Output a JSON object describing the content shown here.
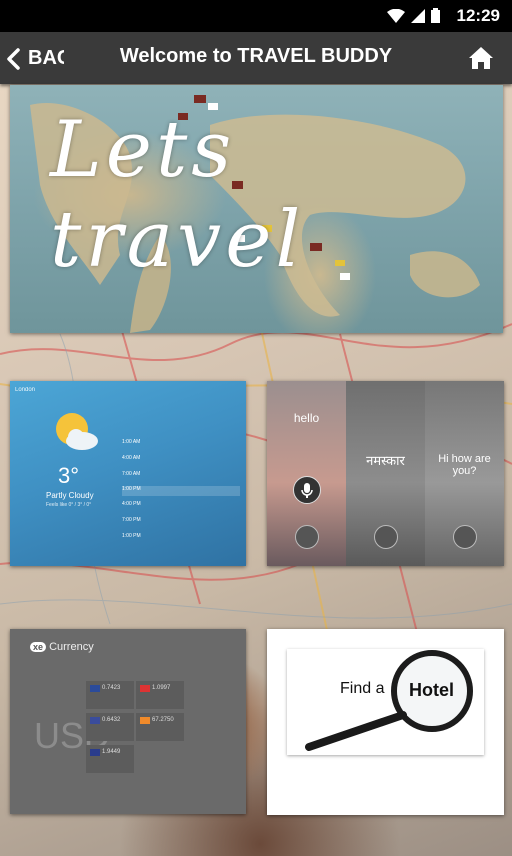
{
  "status_bar": {
    "time": "12:29"
  },
  "action_bar": {
    "back_label": "BAC",
    "title": "Welcome to TRAVEL BUDDY"
  },
  "hero": {
    "tagline": "Lets travel"
  },
  "weather_tile": {
    "city": "London",
    "temperature": "3°",
    "condition": "Partly Cloudy",
    "subline": "Feels like 0° / 3° / 0°",
    "times": [
      "1:00 AM",
      "4:00 AM",
      "7:00 AM",
      "1:00 PM",
      "4:00 PM",
      "7:00 PM",
      "1:00 PM"
    ]
  },
  "translator_tile": {
    "panels": [
      {
        "word": "hello"
      },
      {
        "word": "नमस्कार"
      },
      {
        "word": "Hi how are you?"
      }
    ]
  },
  "currency_tile": {
    "brand": "xe",
    "brand_word": "Currency",
    "base_code": "USD",
    "rates": [
      "0.7423",
      "1.0997",
      "0.6432",
      "67.2750",
      "1.9449"
    ]
  },
  "hotel_tile": {
    "find_label": "Find a",
    "hotel_label": "Hotel"
  }
}
